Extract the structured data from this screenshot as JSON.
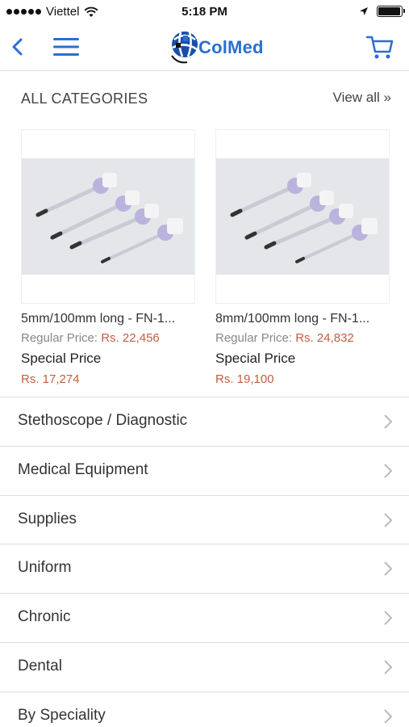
{
  "status": {
    "carrier": "Viettel",
    "time": "5:18 PM",
    "battery_level": 0.95
  },
  "nav": {
    "logo_text": "ColMed",
    "icons": [
      "back-chevron-icon",
      "hamburger-menu-icon",
      "cart-icon"
    ]
  },
  "categories_header": {
    "title": "ALL CATEGORIES",
    "view_all": "View all »"
  },
  "products": [
    {
      "name": "5mm/100mm long - FN-1...",
      "regular_label": "Regular Price:",
      "regular_price": "Rs. 22,456",
      "special_label": "Special Price",
      "special_price": "Rs. 17,274"
    },
    {
      "name": "8mm/100mm long  - FN-1...",
      "regular_label": "Regular Price:",
      "regular_price": "Rs. 24,832",
      "special_label": "Special Price",
      "special_price": "Rs. 19,100"
    }
  ],
  "category_list": [
    {
      "label": "Stethoscope / Diagnostic"
    },
    {
      "label": "Medical Equipment"
    },
    {
      "label": "Supplies"
    },
    {
      "label": "Uniform"
    },
    {
      "label": "Chronic"
    },
    {
      "label": "Dental"
    },
    {
      "label": "By Speciality"
    }
  ],
  "colors": {
    "accent": "#2a6fd0",
    "price": "#c06040",
    "divider": "#dddddd"
  }
}
